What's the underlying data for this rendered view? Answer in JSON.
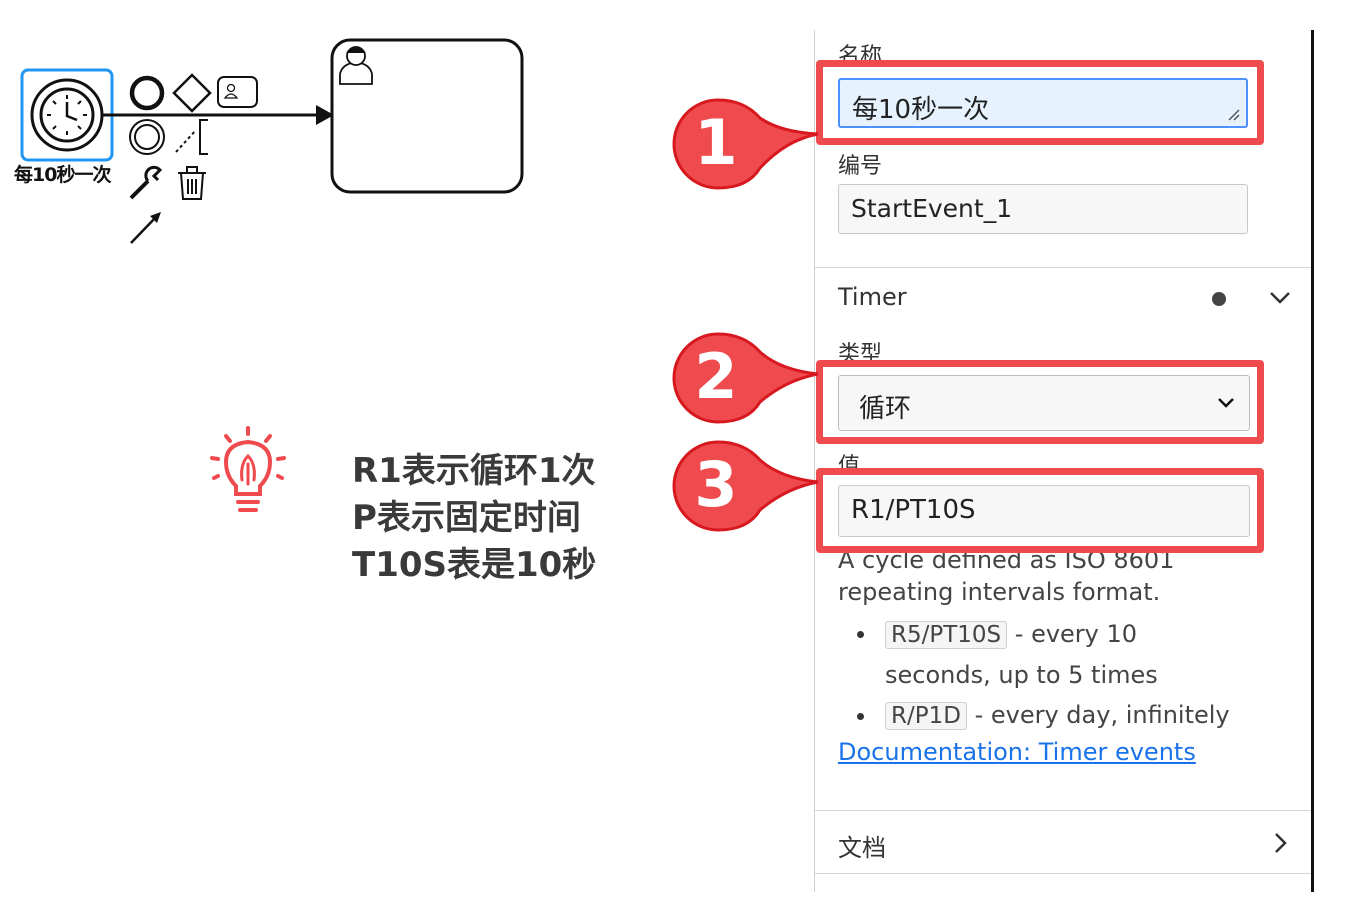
{
  "canvas": {
    "start_event_label": "每10秒一次"
  },
  "tip": {
    "lines": [
      "R1表示循环1次",
      "P表示固定时间",
      "T10S表是10秒"
    ]
  },
  "panel": {
    "name_label": "名称",
    "name_value": "每10秒一次",
    "id_label": "编号",
    "id_value": "StartEvent_1",
    "timer_group_title": "Timer",
    "type_label": "类型",
    "type_value": "循环",
    "value_label": "值",
    "value_value": "R1/PT10S",
    "description_line1": "A cycle defined as ISO 8601",
    "description_line2": "repeating intervals format.",
    "example1_code": "R5/PT10S",
    "example1_text_a": " - every 10",
    "example1_text_b": "seconds, up to 5 times",
    "example2_code": "R/P1D",
    "example2_text": " - every day, infinitely",
    "doc_link": "Documentation: Timer events",
    "docs_group_title": "文档"
  },
  "callouts": {
    "badge1": "1",
    "badge2": "2",
    "badge3": "3",
    "color": "#ef4b4f"
  }
}
